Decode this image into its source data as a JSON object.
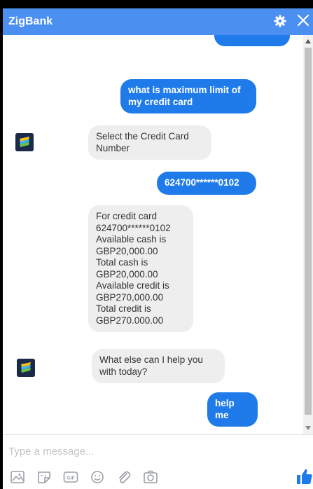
{
  "header": {
    "title": "ZigBank",
    "gear_icon": "gear-icon",
    "close_icon": "close-icon",
    "color": "#4b8ff0"
  },
  "messages": [
    {
      "from": "user",
      "text": "what is maximum limit of\nmy credit card"
    },
    {
      "from": "bot",
      "text": "Select the Credit Card\nNumber"
    },
    {
      "from": "user",
      "text": "624700******0102"
    },
    {
      "from": "bot",
      "text": "For credit card\n624700******0102\nAvailable cash is\nGBP20,000.00\nTotal cash is\nGBP20,000.00\nAvailable credit is\nGBP270,000.00\nTotal credit is\nGBP270.000.00"
    },
    {
      "from": "bot",
      "text": "What else can I help you\nwith today?"
    },
    {
      "from": "user",
      "text": "help me"
    }
  ],
  "composer": {
    "placeholder": "Type a message...",
    "tools": [
      "image-icon",
      "sticker-icon",
      "gif-icon",
      "emoji-icon",
      "attachment-icon",
      "camera-icon"
    ],
    "like_icon": "thumbs-up-icon"
  },
  "colors": {
    "user_bubble": "#1f7bea",
    "bot_bubble": "#eeeeee"
  }
}
